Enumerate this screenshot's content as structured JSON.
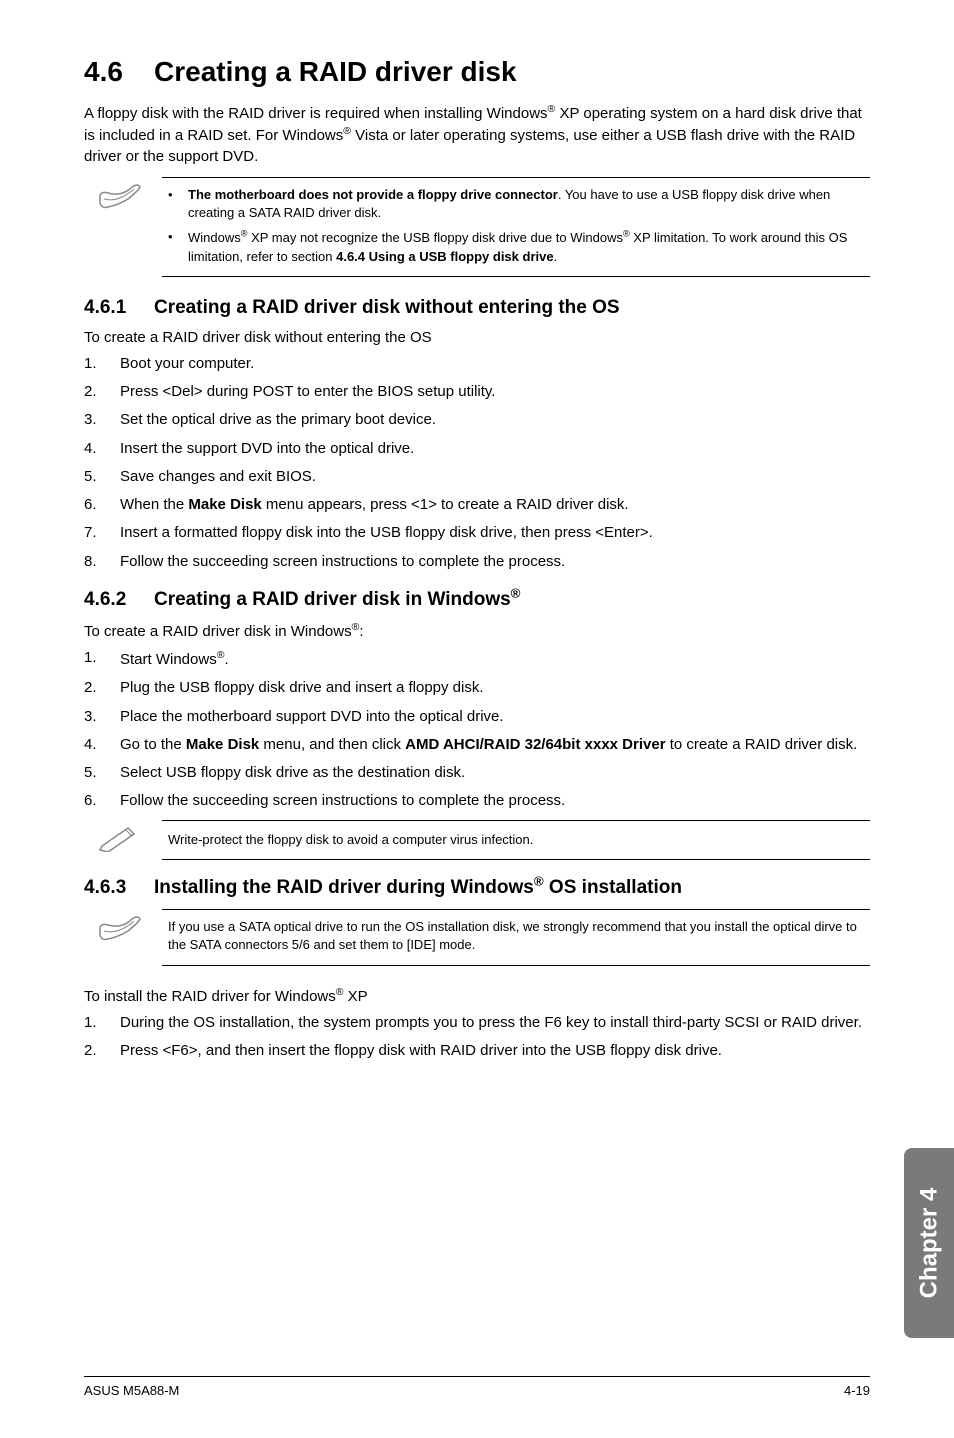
{
  "h1_num": "4.6",
  "h1_title": "Creating a RAID driver disk",
  "intro": "A floppy disk with the RAID driver is required when installing Windows® XP operating system on a hard disk drive that is included in a RAID set. For Windows® Vista or later operating systems, use either a USB flash drive with the RAID driver or the support DVD.",
  "note1_b1_prefix": "The motherboard does not provide a floppy drive connector",
  "note1_b1_rest": ". You have to use a USB floppy disk drive when creating a SATA RAID driver disk.",
  "note1_b2_pre": "Windows® XP may not recognize the USB floppy disk drive due to Windows® XP limitation. To work around this OS limitation, refer to section ",
  "note1_b2_bold": "4.6.4 Using a USB floppy disk drive",
  "note1_b2_post": ".",
  "s461_num": "4.6.1",
  "s461_title": "Creating a RAID driver disk without entering the OS",
  "s461_intro": "To create a RAID driver disk without entering the OS",
  "s461_steps": [
    "Boot your computer.",
    "Press <Del> during POST to enter the BIOS setup utility.",
    "Set the optical drive as the primary boot device.",
    "Insert the support DVD into the optical drive.",
    "Save changes and exit BIOS."
  ],
  "s461_step6_pre": "When the ",
  "s461_step6_bold": "Make Disk",
  "s461_step6_post": " menu appears, press <1> to create a RAID driver disk.",
  "s461_step7": "Insert a formatted floppy disk into the USB floppy disk drive, then press <Enter>.",
  "s461_step8": "Follow the succeeding screen instructions to complete the process.",
  "s462_num": "4.6.2",
  "s462_title": "Creating a RAID driver disk in Windows®",
  "s462_intro": "To create a RAID driver disk in Windows®:",
  "s462_step1": "Start Windows®.",
  "s462_step2": "Plug the USB floppy disk drive and insert a floppy disk.",
  "s462_step3": "Place the motherboard support DVD into the optical drive.",
  "s462_step4_pre": "Go to the ",
  "s462_step4_b1": "Make Disk",
  "s462_step4_mid": " menu, and then click ",
  "s462_step4_b2": "AMD AHCI/RAID 32/64bit xxxx Driver",
  "s462_step4_post": " to create a RAID driver disk.",
  "s462_step5": "Select USB floppy disk drive as the destination disk.",
  "s462_step6": "Follow the succeeding screen instructions to complete the process.",
  "pencil_note": "Write-protect the floppy disk to avoid a computer virus infection.",
  "s463_num": "4.6.3",
  "s463_title": "Installing the RAID driver during Windows® OS installation",
  "note2": "If you use a SATA optical drive to run the OS installation disk, we strongly recommend that you install the optical dirve to the SATA connectors 5/6 and set them to [IDE] mode.",
  "s463_intro": "To install the RAID driver for Windows® XP",
  "s463_step1": "During the OS installation, the system prompts you to press the F6 key to install third-party SCSI or RAID driver.",
  "s463_step2": "Press <F6>, and then insert the floppy disk with RAID driver into the USB floppy disk drive.",
  "chapter_tab": "Chapter 4",
  "footer_left": "ASUS M5A88-M",
  "footer_right": "4-19"
}
